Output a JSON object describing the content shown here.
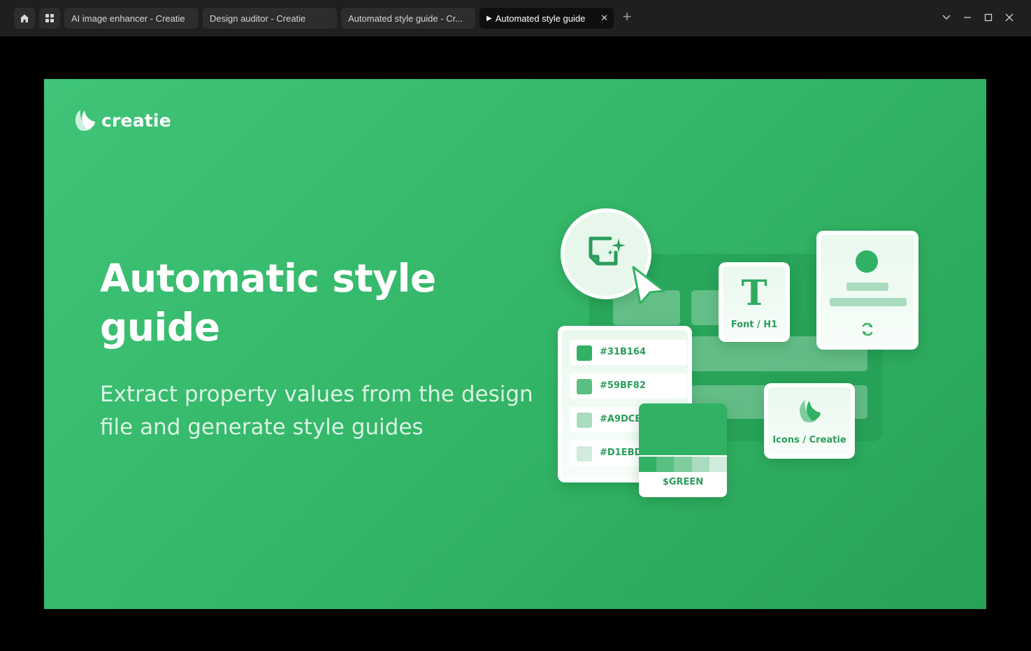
{
  "tabs": [
    {
      "label": "AI image enhancer - Creatie"
    },
    {
      "label": "Design auditor - Creatie"
    },
    {
      "label": "Automated style guide - Cr..."
    },
    {
      "label": "Automated style guide"
    }
  ],
  "slide": {
    "logo_text": "creatie",
    "headline": "Automatic style guide",
    "subtext": "Extract property values from the design file and generate style guides"
  },
  "illustration": {
    "swatches": [
      {
        "label": "#31B164",
        "color": "#31B164"
      },
      {
        "label": "#59BF82",
        "color": "#59BF82"
      },
      {
        "label": "#A9DCBF",
        "color": "#A9DCBF"
      },
      {
        "label": "#D1EBDD",
        "color": "#D1EBDD"
      }
    ],
    "green_token": "$GREEN",
    "font_glyph": "T",
    "font_label": "Font / H1",
    "icons_label": "Icons / Creatie"
  },
  "colors": {
    "brand_green": "#31B164",
    "background_dark": "#000000",
    "tab_bar": "#1F1F1F"
  }
}
